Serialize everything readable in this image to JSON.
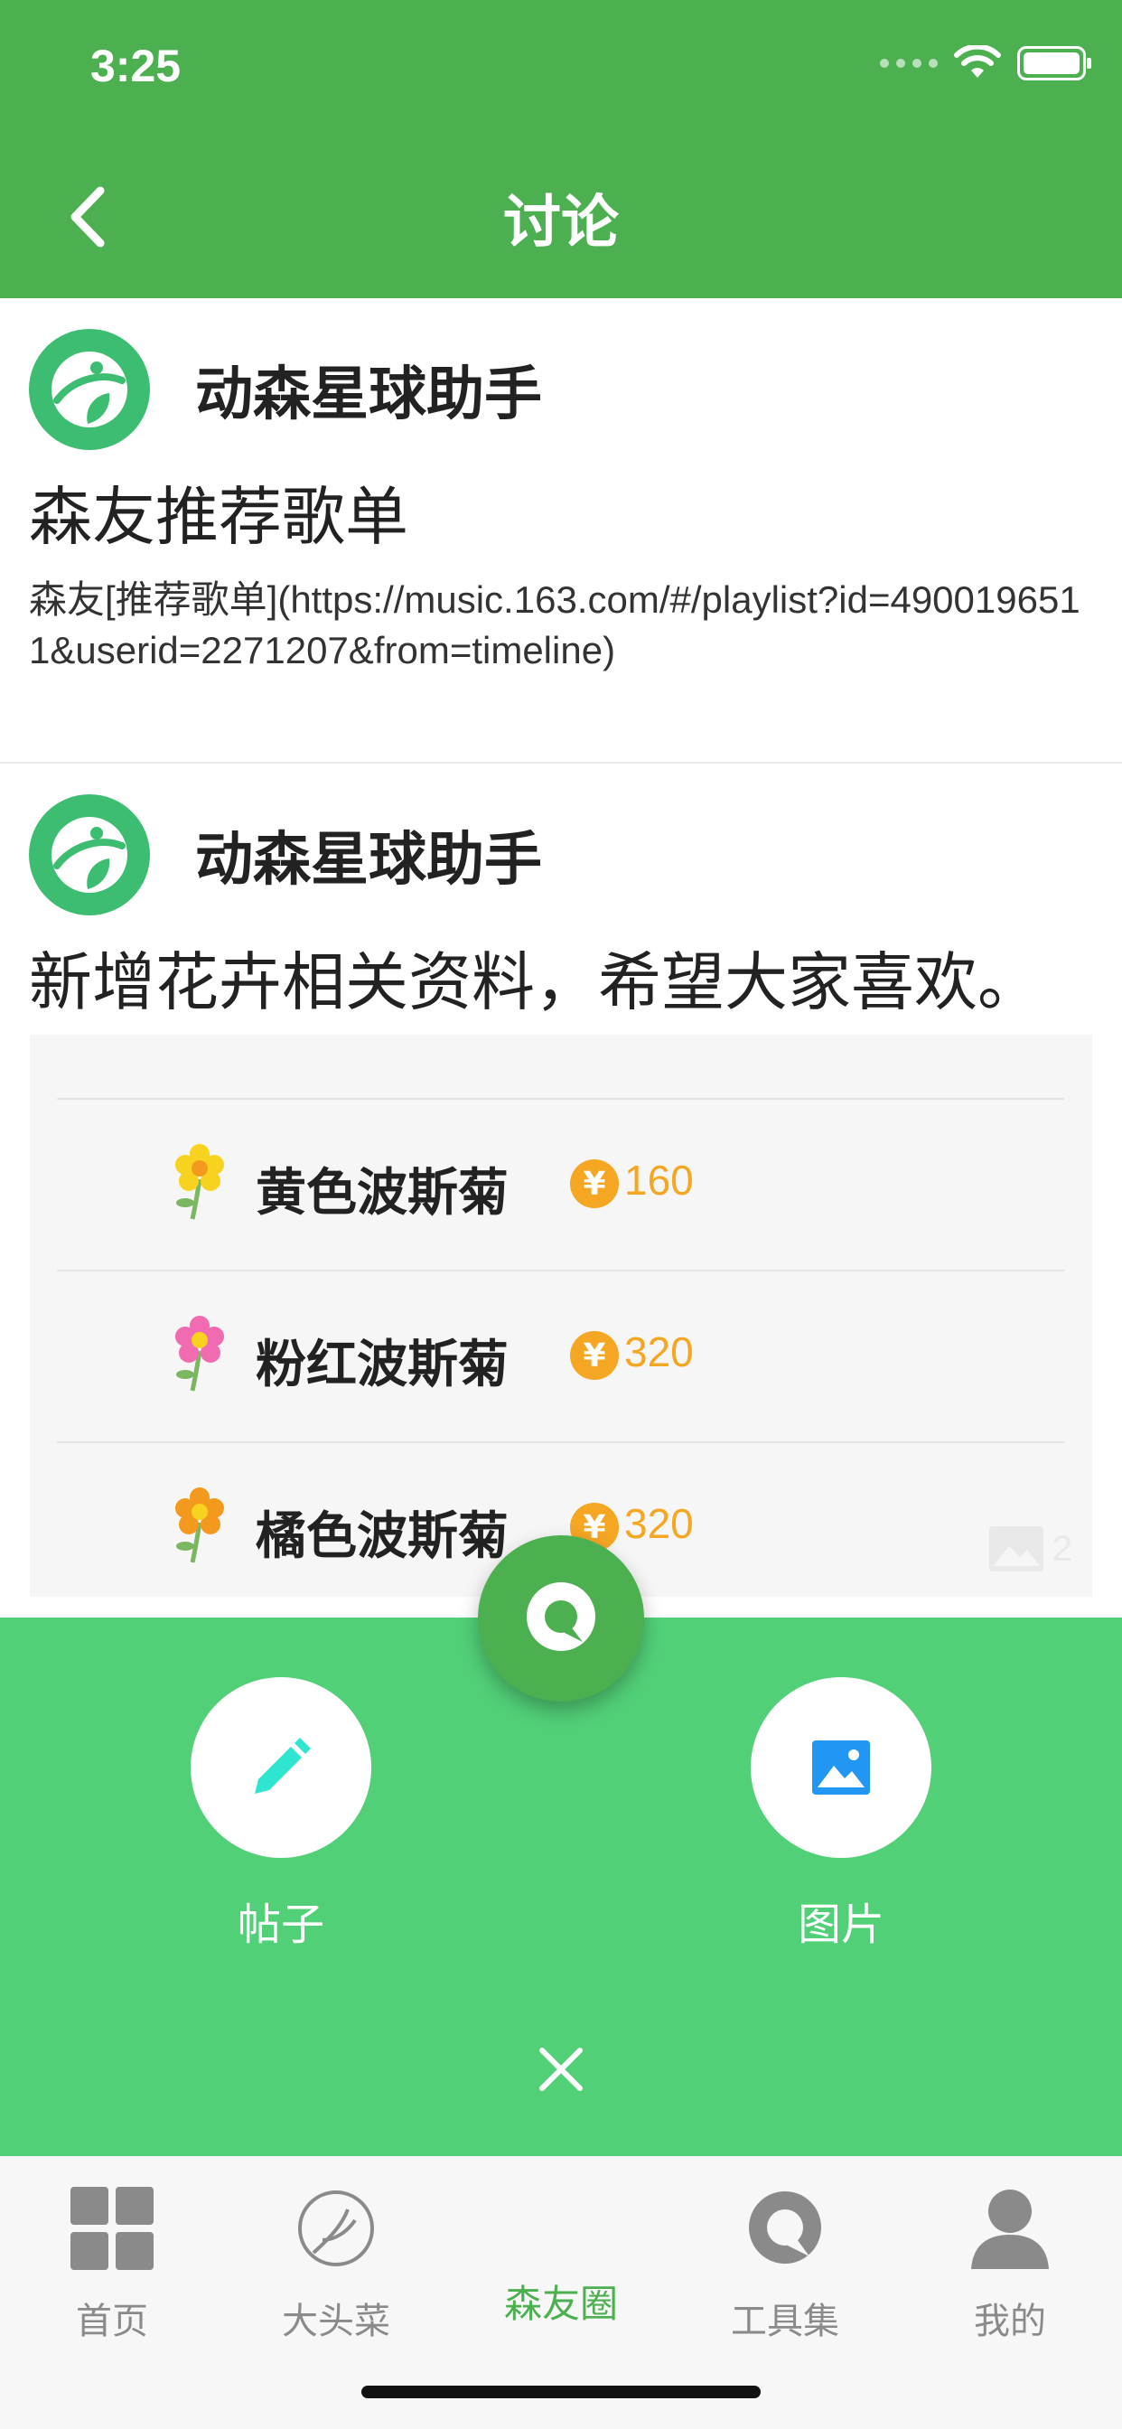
{
  "status_bar": {
    "time": "3:25"
  },
  "header": {
    "title": "讨论",
    "back_icon": "chevron-left-icon"
  },
  "colors": {
    "brand": "#4caf50",
    "panel": "#52d078",
    "price": "#f5a623",
    "avatar": "#3dbd71"
  },
  "posts": [
    {
      "author": "动森星球助手",
      "title": "森友推荐歌单",
      "body": "森友[推荐歌单](https://music.163.com/#/playlist?id=4900196511&userid=2271207&from=timeline)"
    },
    {
      "author": "动森星球助手",
      "title": "新增花卉相关资料，希望大家喜欢。",
      "image": {
        "rows": [
          {
            "name": "黄色波斯菊",
            "currency": "¥",
            "price": "160",
            "color": "#f7d21e"
          },
          {
            "name": "粉红波斯菊",
            "currency": "¥",
            "price": "320",
            "color": "#f06bb1"
          },
          {
            "name": "橘色波斯菊",
            "currency": "¥",
            "price": "320",
            "color": "#f39a1e"
          }
        ],
        "image_count": "2"
      }
    }
  ],
  "action_panel": {
    "post_label": "帖子",
    "image_label": "图片"
  },
  "tabs": [
    {
      "label": "首页",
      "icon": "grid-icon"
    },
    {
      "label": "大头菜",
      "icon": "turnip-icon"
    },
    {
      "label": "森友圈",
      "icon": "",
      "active": true
    },
    {
      "label": "工具集",
      "icon": "chat-bubble-icon"
    },
    {
      "label": "我的",
      "icon": "user-icon"
    }
  ]
}
